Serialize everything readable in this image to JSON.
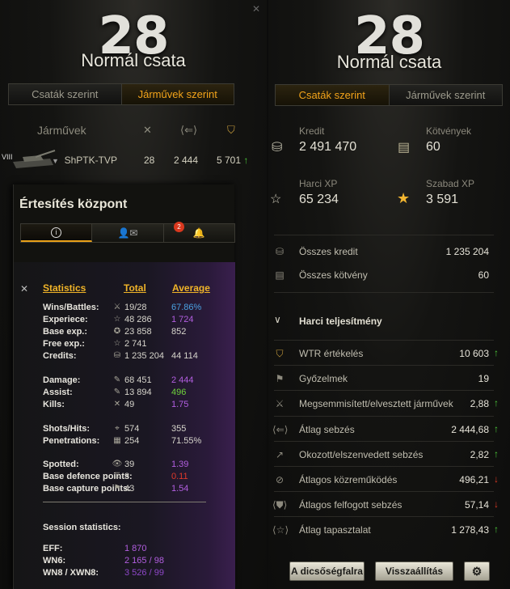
{
  "left": {
    "battle_count": "28",
    "mode": "Normál csata",
    "tabs": [
      "Csaták szerint",
      "Járművek szerint"
    ],
    "vehicles_header": "Járművek",
    "vehicle": {
      "tier": "VIII",
      "name": "ShPTK-TVP",
      "battles": "28",
      "damage": "2 444",
      "wtr": "5 701"
    }
  },
  "notifications": {
    "title": "Értesítés központ",
    "badge_count": "2",
    "headers": {
      "statistics": "Statistics",
      "total": "Total",
      "average": "Average"
    },
    "stats": [
      {
        "label": "Wins/Battles:",
        "total": "19/28",
        "avg": "67.86%",
        "color": "#4aa0e0"
      },
      {
        "label": "Experiece:",
        "total": "48 286",
        "avg": "1 724",
        "color": "#b25ee0"
      },
      {
        "label": "Base exp.:",
        "total": "23 858",
        "avg": "852",
        "color": "#d7d5cc"
      },
      {
        "label": "Free exp.:",
        "total": "2 741",
        "avg": "",
        "color": "#d7d5cc"
      },
      {
        "label": "Credits:",
        "total": "1 235 204",
        "avg": "44 114",
        "color": "#d7d5cc"
      },
      {
        "label": "Damage:",
        "total": "68 451",
        "avg": "2 444",
        "color": "#b25ee0"
      },
      {
        "label": "Assist:",
        "total": "13 894",
        "avg": "496",
        "color": "#6fd23c"
      },
      {
        "label": "Kills:",
        "total": "49",
        "avg": "1.75",
        "color": "#b25ee0"
      },
      {
        "label": "Shots/Hits:",
        "total": "574",
        "avg": "355",
        "color": "#d7d5cc"
      },
      {
        "label": "Penetrations:",
        "total": "254",
        "avg": "71.55%",
        "color": "#d7d5cc"
      },
      {
        "label": "Spotted:",
        "total": "39",
        "avg": "1.39",
        "color": "#b25ee0"
      },
      {
        "label": "Base defence points:",
        "total": "3",
        "avg": "0.11",
        "color": "#e0392a"
      },
      {
        "label": "Base capture points:",
        "total": "43",
        "avg": "1.54",
        "color": "#b25ee0"
      }
    ],
    "session_title": "Session statistics:",
    "session": [
      {
        "label": "EFF:",
        "value": "1 870",
        "color": "#b25ee0"
      },
      {
        "label": "WN6:",
        "value": "2 165 / 98",
        "color": "#b25ee0"
      },
      {
        "label": "WN8 / XWN8:",
        "value": "3 526 / 99",
        "color": "#8e47c8"
      }
    ]
  },
  "right": {
    "battle_count": "28",
    "mode": "Normál csata",
    "tabs": [
      "Csaták szerint",
      "Járművek szerint"
    ],
    "kredit_label": "Kredit",
    "kredit_value": "2 491 470",
    "kotveny_label": "Kötvények",
    "kotveny_value": "60",
    "harci_xp_label": "Harci XP",
    "harci_xp_value": "65 234",
    "szabad_xp_label": "Szabad XP",
    "szabad_xp_value": "3 591",
    "totals": [
      {
        "label": "Összes kredit",
        "value": "1 235 204"
      },
      {
        "label": "Összes kötvény",
        "value": "60"
      }
    ],
    "section_title": "Harci teljesítmény",
    "perf": [
      {
        "label": "WTR értékelés",
        "value": "10 603",
        "arrow": "↑",
        "dir": "up"
      },
      {
        "label": "Győzelmek",
        "value": "19",
        "arrow": "",
        "dir": "none"
      },
      {
        "label": "Megsemmisített/elvesztett járművek",
        "value": "2,88",
        "arrow": "↑",
        "dir": "up"
      },
      {
        "label": "Átlag sebzés",
        "value": "2 444,68",
        "arrow": "↑",
        "dir": "up"
      },
      {
        "label": "Okozott/elszenvedett sebzés",
        "value": "2,82",
        "arrow": "↑",
        "dir": "up"
      },
      {
        "label": "Átlagos közreműködés",
        "value": "496,21",
        "arrow": "↓",
        "dir": "down"
      },
      {
        "label": "Átlagos felfogott sebzés",
        "value": "57,14",
        "arrow": "↓",
        "dir": "down"
      },
      {
        "label": "Átlag tapasztalat",
        "value": "1 278,43",
        "arrow": "↑",
        "dir": "up"
      }
    ],
    "buttons": {
      "glory": "A dicsőségfalra",
      "reset": "Visszaállítás"
    }
  }
}
